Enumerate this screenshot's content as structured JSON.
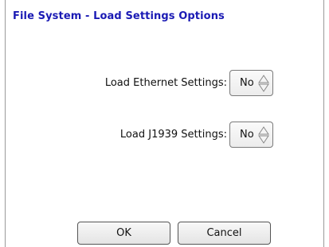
{
  "dialog": {
    "title": "File System - Load Settings Options"
  },
  "settings": [
    {
      "label": "Load Ethernet Settings:",
      "value": "No"
    },
    {
      "label": "Load J1939 Settings:",
      "value": "No"
    }
  ],
  "buttons": {
    "ok_label": "OK",
    "cancel_label": "Cancel"
  }
}
